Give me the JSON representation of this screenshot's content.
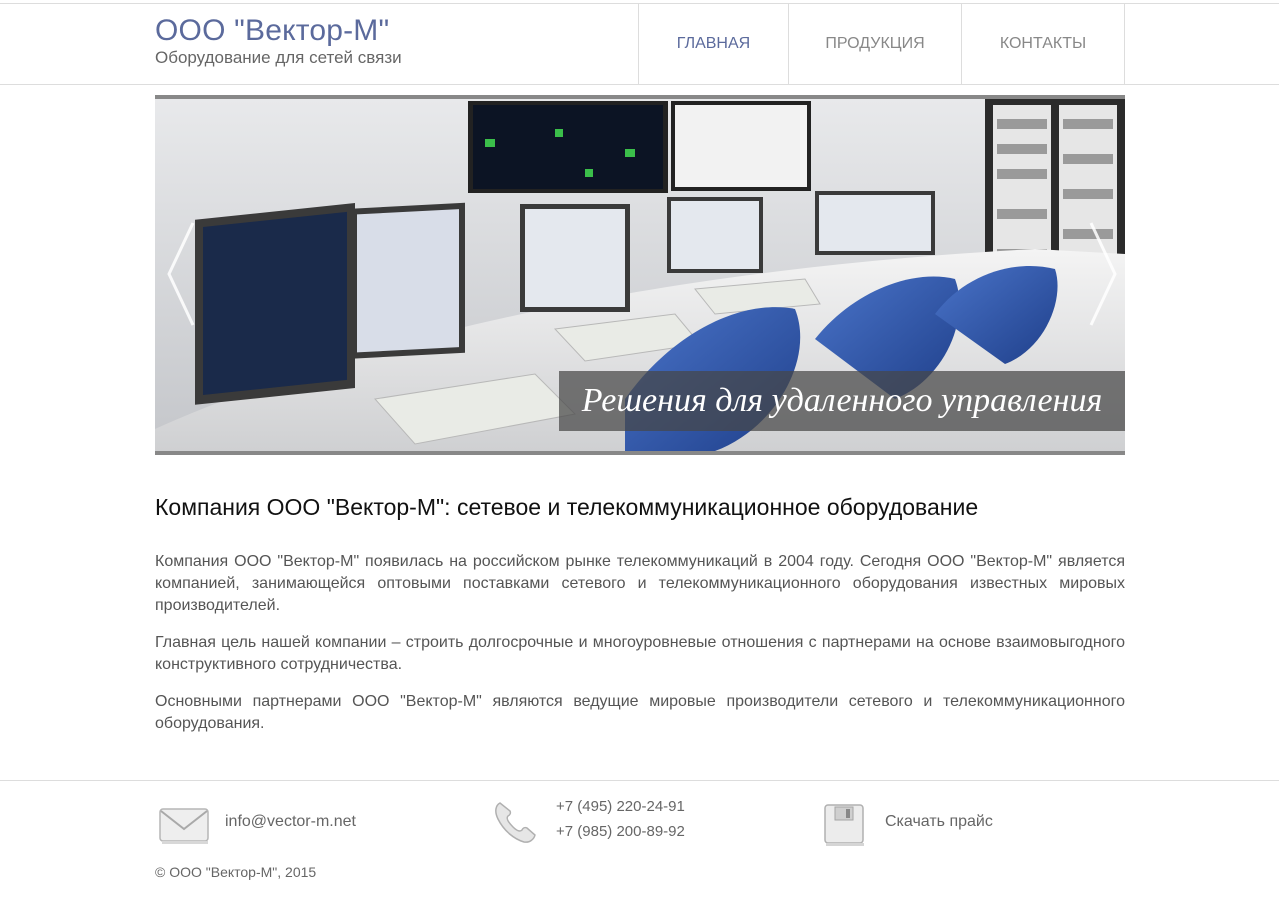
{
  "header": {
    "brand_title": "ООО \"Вектор-М\"",
    "brand_subtitle": "Оборудование для сетей связи",
    "nav": [
      {
        "label": "ГЛАВНАЯ",
        "active": true
      },
      {
        "label": "ПРОДУКЦИЯ",
        "active": false
      },
      {
        "label": "КОНТАКТЫ",
        "active": false
      }
    ]
  },
  "slider": {
    "caption": "Решения для удаленного управления",
    "prev_icon": "chevron-left-icon",
    "next_icon": "chevron-right-icon"
  },
  "main": {
    "title": "Компания ООО \"Вектор-М\": сетевое и телекоммуникационное оборудование",
    "paragraphs": [
      "Компания ООО \"Вектор-М\" появилась на российском рынке телекоммуникаций в 2004 году. Сегодня ООО \"Вектор-М\" является компанией, занимающейся оптовыми поставками сетевого и телекоммуникационного оборудования известных мировых производителей.",
      "Главная цель нашей компании – строить долгосрочные и многоуровневые отношения с партнерами на основе взаимовыгодного конструктивного сотрудничества.",
      "Основными партнерами ООО \"Вектор-М\" являются ведущие мировые производители сетевого и телекоммуникационного оборудования."
    ]
  },
  "footer": {
    "email": "info@vector-m.net",
    "phones": [
      "+7 (495) 220-24-91",
      "+7 (985) 200-89-92"
    ],
    "price_link": "Скачать прайс",
    "copyright": "© ООО \"Вектор-М\", 2015",
    "icons": [
      "envelope-icon",
      "phone-icon",
      "download-icon"
    ]
  },
  "colors": {
    "brand": "#5b6a9c",
    "caption_bg": "#464646"
  }
}
